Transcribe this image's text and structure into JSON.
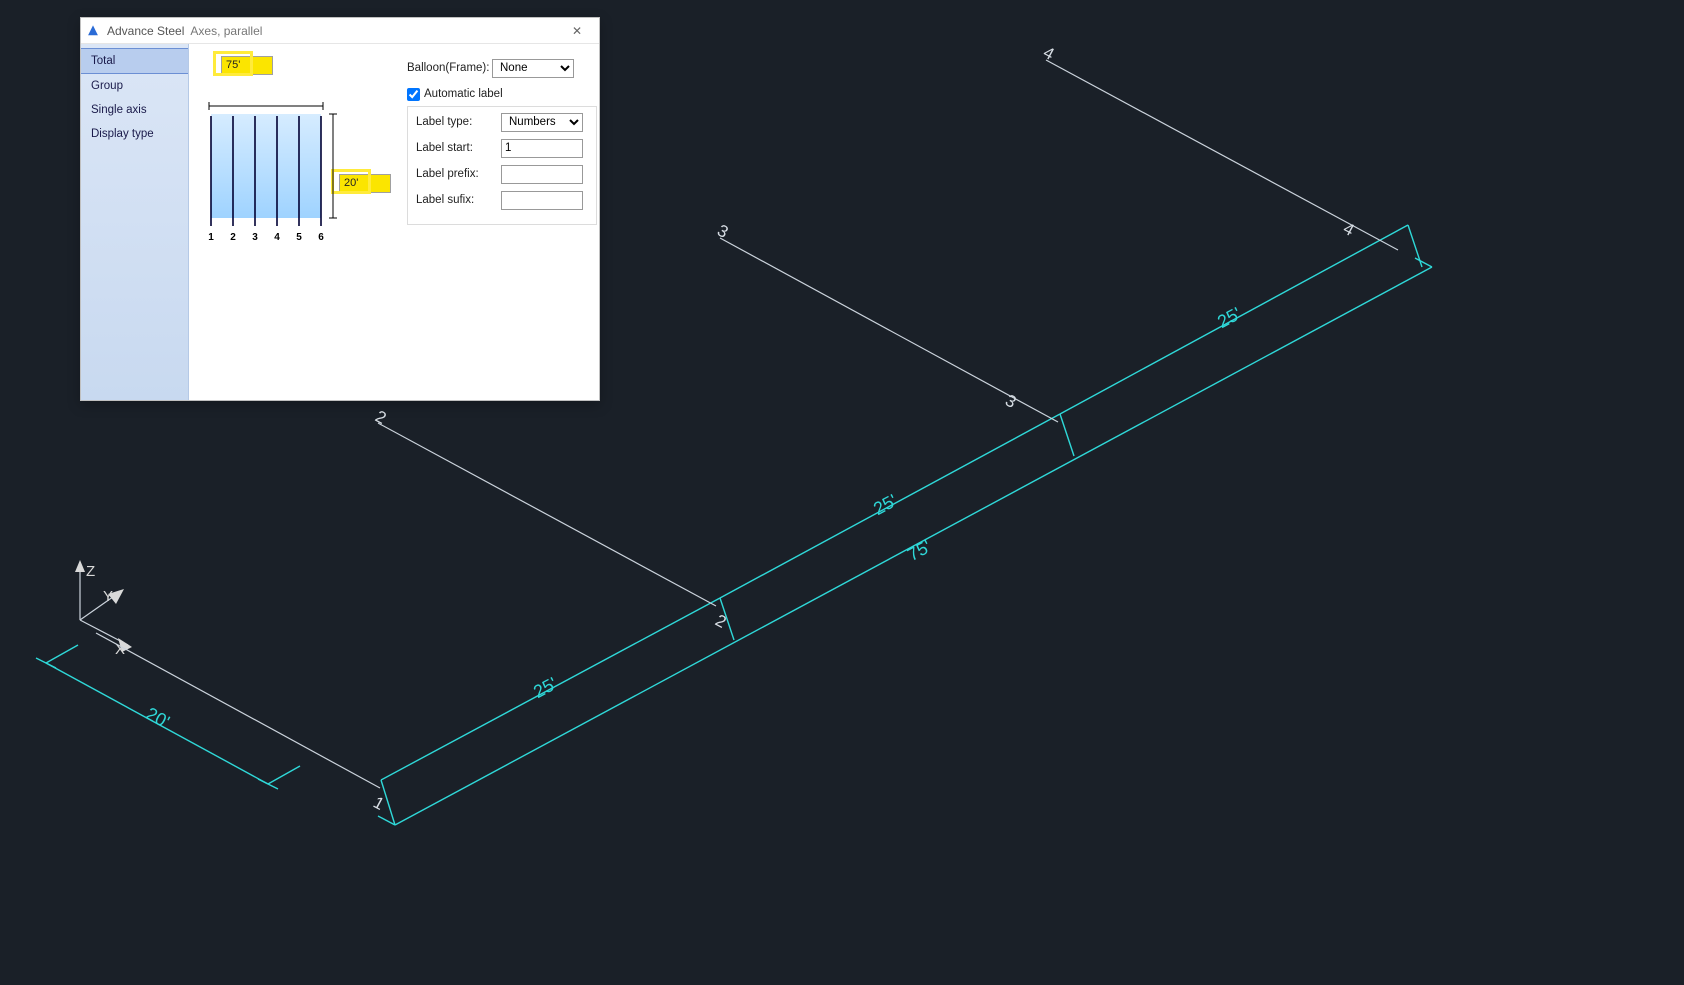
{
  "dialog": {
    "app_name": "Advance Steel",
    "subtitle": "Axes, parallel",
    "close_glyph": "✕",
    "sidebar": {
      "items": [
        {
          "label": "Total",
          "selected": true
        },
        {
          "label": "Group"
        },
        {
          "label": "Single axis"
        },
        {
          "label": "Display type"
        }
      ]
    },
    "width_value": "75'",
    "height_value": "20'",
    "preview_labels": [
      "1",
      "2",
      "3",
      "4",
      "5",
      "6"
    ],
    "balloon_label": "Balloon(Frame):",
    "balloon_value": "None",
    "auto_label_checked": true,
    "auto_label_text": "Automatic label",
    "label_type_label": "Label type:",
    "label_type_value": "Numbers",
    "label_start_label": "Label start:",
    "label_start_value": "1",
    "label_prefix_label": "Label prefix:",
    "label_prefix_value": "",
    "label_sufix_label": "Label sufix:",
    "label_sufix_value": ""
  },
  "viewport": {
    "ucs": {
      "x": "X",
      "y": "Y",
      "z": "Z"
    },
    "dims": {
      "span_total": "75'",
      "span_seg1": "25'",
      "span_seg2": "25'",
      "span_seg3": "25'",
      "depth": "20'"
    },
    "axis_labels": {
      "a1": "1",
      "a2": "2",
      "a3": "3",
      "a4": "4"
    }
  }
}
